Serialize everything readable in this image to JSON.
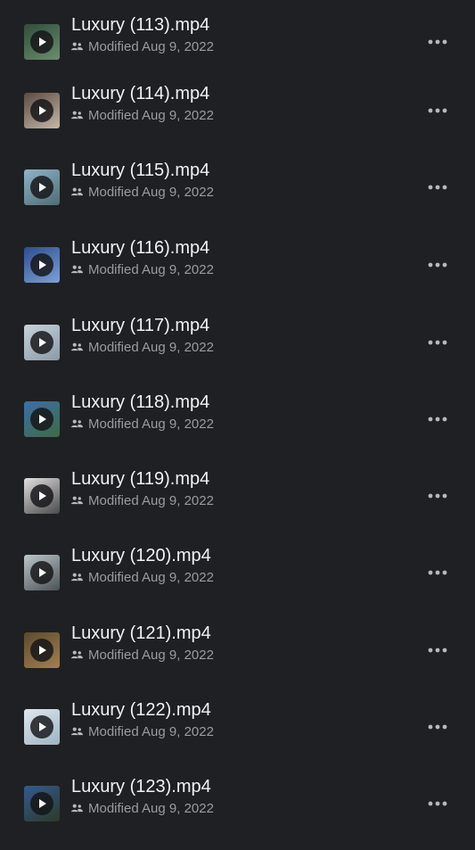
{
  "files": [
    {
      "name": "Luxury (113).mp4",
      "meta": "Modified Aug 9, 2022",
      "colors": [
        "#2f4d3a",
        "#6d8c6f"
      ]
    },
    {
      "name": "Luxury (114).mp4",
      "meta": "Modified Aug 9, 2022",
      "colors": [
        "#5b4a42",
        "#c6b7a6"
      ]
    },
    {
      "name": "Luxury (115).mp4",
      "meta": "Modified Aug 9, 2022",
      "colors": [
        "#8fb3c8",
        "#4f6d74"
      ]
    },
    {
      "name": "Luxury (116).mp4",
      "meta": "Modified Aug 9, 2022",
      "colors": [
        "#2d4d8e",
        "#7da0d6"
      ]
    },
    {
      "name": "Luxury (117).mp4",
      "meta": "Modified Aug 9, 2022",
      "colors": [
        "#c8d3db",
        "#8b9aa6"
      ]
    },
    {
      "name": "Luxury (118).mp4",
      "meta": "Modified Aug 9, 2022",
      "colors": [
        "#3c6ea8",
        "#3f6a45"
      ]
    },
    {
      "name": "Luxury (119).mp4",
      "meta": "Modified Aug 9, 2022",
      "colors": [
        "#e1e1e1",
        "#4a4a4a"
      ]
    },
    {
      "name": "Luxury (120).mp4",
      "meta": "Modified Aug 9, 2022",
      "colors": [
        "#bcc7cc",
        "#4b5255"
      ]
    },
    {
      "name": "Luxury (121).mp4",
      "meta": "Modified Aug 9, 2022",
      "colors": [
        "#5b4a2f",
        "#a37f52"
      ]
    },
    {
      "name": "Luxury (122).mp4",
      "meta": "Modified Aug 9, 2022",
      "colors": [
        "#dfe7ee",
        "#9fb4c3"
      ]
    },
    {
      "name": "Luxury (123).mp4",
      "meta": "Modified Aug 9, 2022",
      "colors": [
        "#355a8f",
        "#2b3a2a"
      ]
    }
  ],
  "icons": {
    "play": "play-icon",
    "shared": "people-icon",
    "more": "more-horizontal-icon"
  },
  "theme": {
    "background": "#1f2023",
    "title_color": "#f2f2f4",
    "meta_color": "#9a9ba1",
    "icon_color": "#b8b9be"
  }
}
